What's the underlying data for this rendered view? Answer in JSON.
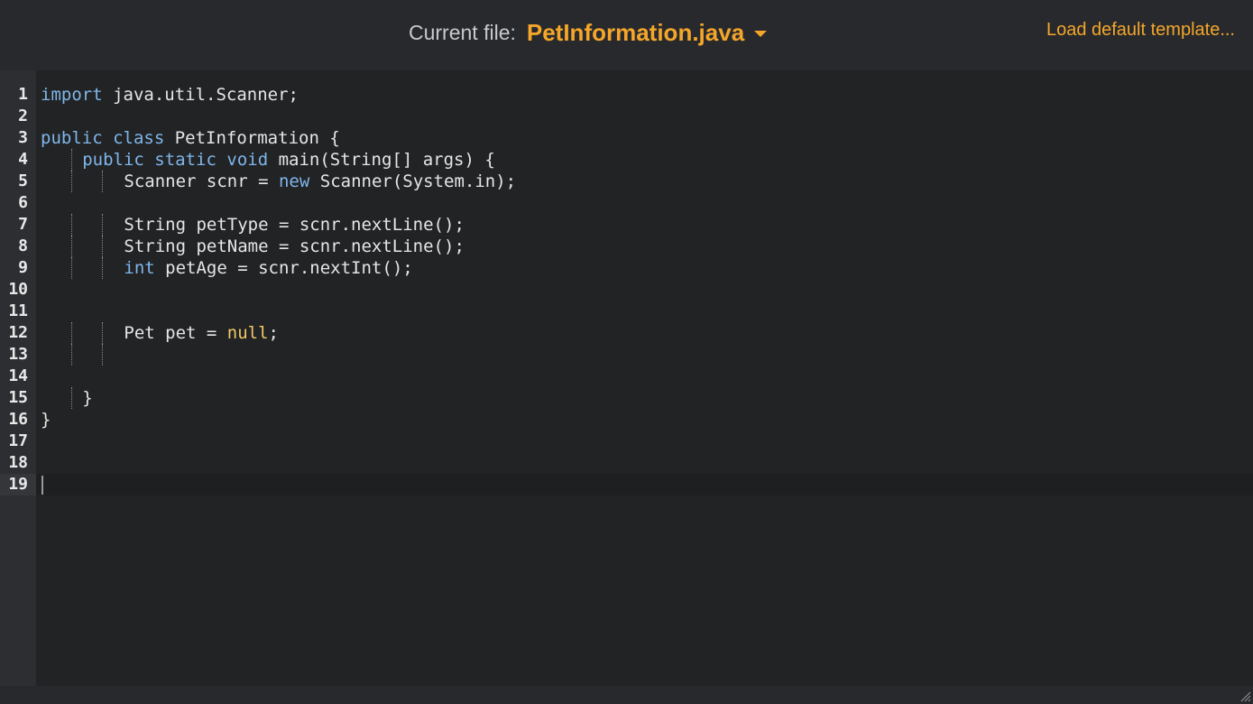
{
  "header": {
    "current_file_label": "Current file:",
    "file_name": "PetInformation.java",
    "load_template_label": "Load default template..."
  },
  "editor": {
    "active_line": 19,
    "lines": [
      {
        "num": "1",
        "indent": 0,
        "tokens": [
          {
            "t": "import",
            "k": "kw"
          },
          {
            "t": " java.util.Scanner;",
            "k": ""
          }
        ]
      },
      {
        "num": "2",
        "indent": 0,
        "tokens": []
      },
      {
        "num": "3",
        "indent": 0,
        "tokens": [
          {
            "t": "public",
            "k": "kw"
          },
          {
            "t": " ",
            "k": ""
          },
          {
            "t": "class",
            "k": "kw"
          },
          {
            "t": " PetInformation {",
            "k": ""
          }
        ]
      },
      {
        "num": "4",
        "indent": 1,
        "tokens": [
          {
            "t": "public",
            "k": "kw"
          },
          {
            "t": " ",
            "k": ""
          },
          {
            "t": "static",
            "k": "kw"
          },
          {
            "t": " ",
            "k": ""
          },
          {
            "t": "void",
            "k": "kw"
          },
          {
            "t": " main(String[] args) {",
            "k": ""
          }
        ]
      },
      {
        "num": "5",
        "indent": 2,
        "tokens": [
          {
            "t": "Scanner scnr = ",
            "k": ""
          },
          {
            "t": "new",
            "k": "kw"
          },
          {
            "t": " Scanner(System.in);",
            "k": ""
          }
        ]
      },
      {
        "num": "6",
        "indent": 0,
        "tokens": []
      },
      {
        "num": "7",
        "indent": 2,
        "tokens": [
          {
            "t": "String petType = scnr.nextLine();",
            "k": ""
          }
        ]
      },
      {
        "num": "8",
        "indent": 2,
        "tokens": [
          {
            "t": "String petName = scnr.nextLine();",
            "k": ""
          }
        ]
      },
      {
        "num": "9",
        "indent": 2,
        "tokens": [
          {
            "t": "int",
            "k": "kw"
          },
          {
            "t": " petAge = scnr.nextInt();",
            "k": ""
          }
        ]
      },
      {
        "num": "10",
        "indent": 0,
        "tokens": []
      },
      {
        "num": "11",
        "indent": 0,
        "tokens": []
      },
      {
        "num": "12",
        "indent": 2,
        "tokens": [
          {
            "t": "Pet pet = ",
            "k": ""
          },
          {
            "t": "null",
            "k": "lit"
          },
          {
            "t": ";",
            "k": ""
          }
        ]
      },
      {
        "num": "13",
        "indent": 2,
        "tokens": []
      },
      {
        "num": "14",
        "indent": 0,
        "tokens": []
      },
      {
        "num": "15",
        "indent": 1,
        "tokens": [
          {
            "t": "}",
            "k": ""
          }
        ]
      },
      {
        "num": "16",
        "indent": 0,
        "tokens": [
          {
            "t": "}",
            "k": ""
          }
        ]
      },
      {
        "num": "17",
        "indent": 0,
        "tokens": []
      },
      {
        "num": "18",
        "indent": 0,
        "tokens": []
      },
      {
        "num": "19",
        "indent": 0,
        "tokens": []
      }
    ]
  },
  "colors": {
    "accent": "#f4a62a",
    "keyword": "#7fb6ea",
    "literal": "#f0c866",
    "text": "#e6e6e6",
    "background": "#222325"
  }
}
